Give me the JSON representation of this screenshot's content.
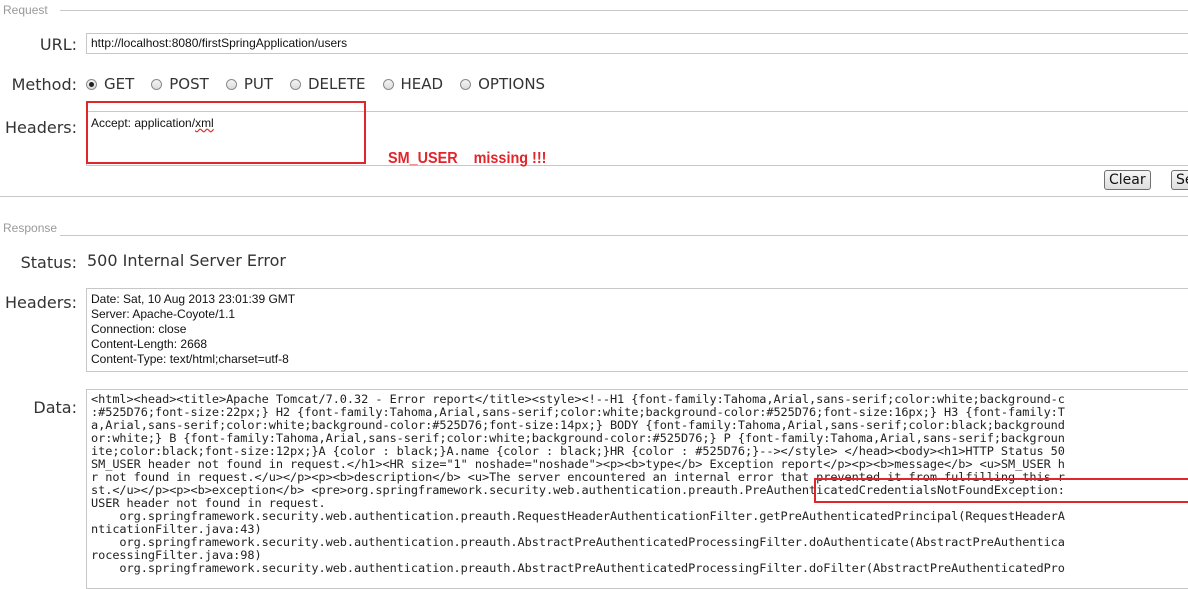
{
  "request": {
    "legend": "Request",
    "url_label": "URL:",
    "url_value": "http://localhost:8080/firstSpringApplication/users",
    "method_label": "Method:",
    "methods": [
      "GET",
      "POST",
      "PUT",
      "DELETE",
      "HEAD",
      "OPTIONS"
    ],
    "selected_method": "GET",
    "headers_label": "Headers:",
    "headers_value_prefix": "Accept: application/",
    "headers_value_suffix": "xml",
    "clear_label": "Clear",
    "send_label": "Se"
  },
  "annotation": {
    "text": "SM_USER    missing !!!",
    "color": "#e0252b"
  },
  "response": {
    "legend": "Response",
    "status_label": "Status:",
    "status_value": "500 Internal Server Error",
    "headers_label": "Headers:",
    "header_lines": [
      "Date: Sat, 10 Aug 2013 23:01:39 GMT",
      "Server: Apache-Coyote/1.1",
      "Connection: close",
      "Content-Length: 2668",
      "Content-Type: text/html;charset=utf-8"
    ],
    "data_label": "Data:",
    "data_lines": [
      "<html><head><title>Apache Tomcat/7.0.32 - Error report</title><style><!--H1 {font-family:Tahoma,Arial,sans-serif;color:white;background-c",
      ":#525D76;font-size:22px;} H2 {font-family:Tahoma,Arial,sans-serif;color:white;background-color:#525D76;font-size:16px;} H3 {font-family:T",
      "a,Arial,sans-serif;color:white;background-color:#525D76;font-size:14px;} BODY {font-family:Tahoma,Arial,sans-serif;color:black;background",
      "or:white;} B {font-family:Tahoma,Arial,sans-serif;color:white;background-color:#525D76;} P {font-family:Tahoma,Arial,sans-serif;backgroun",
      "ite;color:black;font-size:12px;}A {color : black;}A.name {color : black;}HR {color : #525D76;}--></style> </head><body><h1>HTTP Status 50",
      "SM_USER header not found in request.</h1><HR size=\"1\" noshade=\"noshade\"><p><b>type</b> Exception report</p><p><b>message</b> <u>SM_USER h",
      "r not found in request.</u></p><p><b>description</b> <u>The server encountered an internal error that prevented it from fulfilling this r",
      "st.</u></p><p><b>exception</b> <pre>org.springframework.security.web.authentication.preauth.PreAuthenticatedCredentialsNotFoundException:",
      "USER header not found in request.",
      "    org.springframework.security.web.authentication.preauth.RequestHeaderAuthenticationFilter.getPreAuthenticatedPrincipal(RequestHeaderA",
      "nticationFilter.java:43)",
      "    org.springframework.security.web.authentication.preauth.AbstractPreAuthenticatedProcessingFilter.doAuthenticate(AbstractPreAuthentica",
      "rocessingFilter.java:98)",
      "    org.springframework.security.web.authentication.preauth.AbstractPreAuthenticatedProcessingFilter.doFilter(AbstractPreAuthenticatedPro"
    ]
  }
}
